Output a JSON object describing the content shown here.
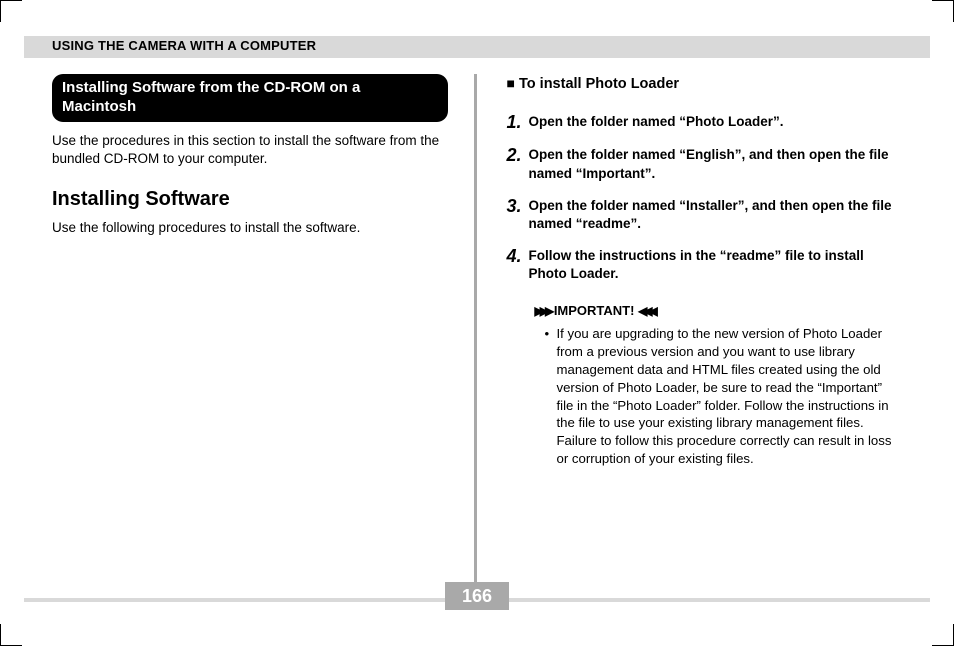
{
  "header": {
    "title": "USING THE CAMERA WITH A COMPUTER"
  },
  "left": {
    "boxed_heading": "Installing Software from the CD-ROM on a Macintosh",
    "intro_para": "Use the procedures in this section to install the software from the bundled CD-ROM to your computer.",
    "sub_heading": "Installing Software",
    "sub_para": "Use the following procedures to install the software."
  },
  "right": {
    "square_heading": "To install Photo Loader",
    "steps": [
      {
        "n": "1.",
        "text": "Open the folder named “Photo Loader”."
      },
      {
        "n": "2.",
        "text": "Open the folder named “English”, and then open the file named “Important”."
      },
      {
        "n": "3.",
        "text": "Open the folder named “Installer”, and then open the file named “readme”."
      },
      {
        "n": "4.",
        "text": "Follow the instructions in the “readme” file to install Photo Loader."
      }
    ],
    "important_label": "IMPORTANT!",
    "important_bullet": "If you are upgrading to the new version of Photo Loader from a previous version and you want to use library management data and HTML files created using the old version of Photo Loader, be sure to read the “Important” file in the “Photo Loader” folder. Follow the instructions in the file to use your existing library management files. Failure to follow this procedure correctly can result in loss or corruption of your existing files."
  },
  "page_number": "166"
}
